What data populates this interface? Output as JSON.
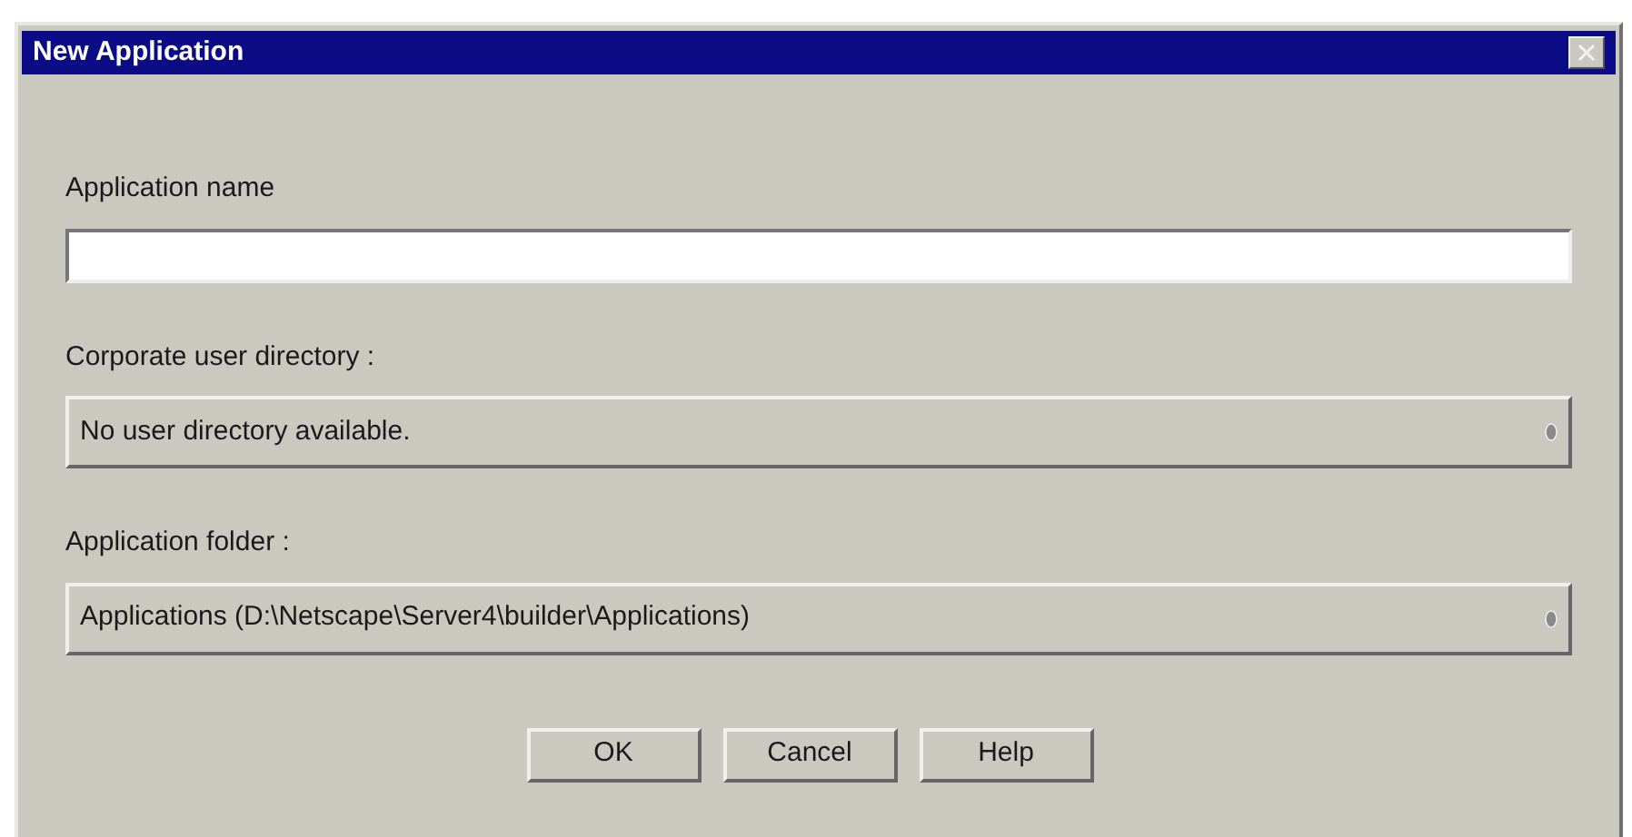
{
  "window": {
    "title": "New Application"
  },
  "fields": [
    {
      "kind": "text",
      "label": "Application name"
    },
    {
      "kind": "dropdown",
      "label": "Corporate user directory :",
      "value": "No user directory available."
    },
    {
      "kind": "dropdown",
      "label": "Application folder :",
      "value": "Applications (D:\\Netscape\\Server4\\builder\\Applications)"
    }
  ],
  "buttons": [
    "OK",
    "Cancel",
    "Help"
  ]
}
